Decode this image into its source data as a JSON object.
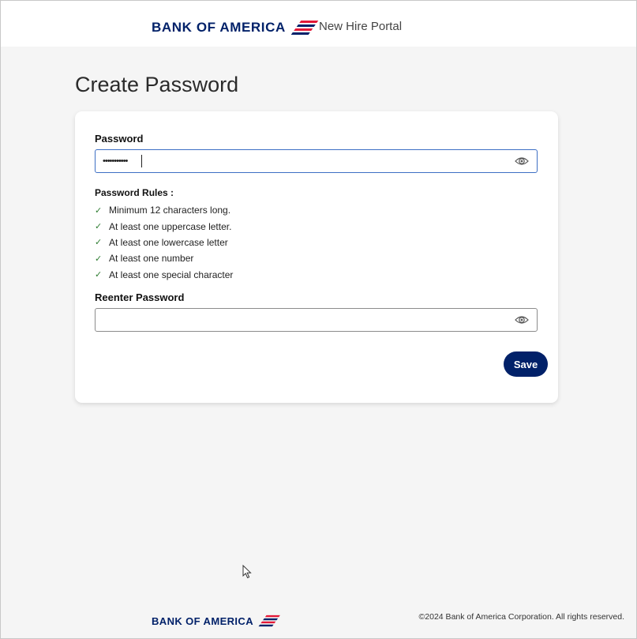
{
  "header": {
    "brand_name": "BANK OF AMERICA",
    "portal_name": "New Hire Portal"
  },
  "page": {
    "title": "Create Password"
  },
  "form": {
    "password": {
      "label": "Password",
      "value": "•••••••••••",
      "toggle_icon": "eye-icon"
    },
    "rules": {
      "title": "Password Rules :",
      "items": [
        {
          "text": "Minimum 12 characters long.",
          "status": "met"
        },
        {
          "text": "At least one uppercase letter.",
          "status": "met"
        },
        {
          "text": "At least one lowercase letter",
          "status": "met"
        },
        {
          "text": "At least one number",
          "status": "met"
        },
        {
          "text": "At least one special character",
          "status": "met"
        }
      ]
    },
    "reenter": {
      "label": "Reenter Password",
      "value": "",
      "toggle_icon": "eye-icon"
    },
    "save_label": "Save"
  },
  "footer": {
    "brand_name": "BANK OF AMERICA",
    "copyright": "©2024 Bank of America Corporation. All rights reserved."
  },
  "colors": {
    "brand_navy": "#012169",
    "brand_red": "#e31837",
    "check_green": "#2e7d32",
    "page_background": "#f5f5f5",
    "focus_border": "#3d6fc4"
  }
}
